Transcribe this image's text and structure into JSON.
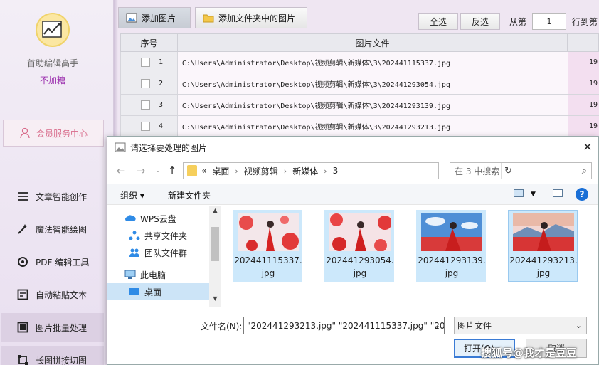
{
  "sidebar": {
    "app_name": "首助编辑高手",
    "user_name": "不加糖",
    "member_center": "会员服务中心",
    "nav": [
      {
        "label": "文章智能创作",
        "icon": "list-icon"
      },
      {
        "label": "魔法智能绘图",
        "icon": "magic-wand-icon"
      },
      {
        "label": "PDF 编辑工具",
        "icon": "pdf-gear-icon"
      },
      {
        "label": "自动粘贴文本",
        "icon": "paste-icon"
      },
      {
        "label": "图片批量处理",
        "icon": "image-batch-icon"
      },
      {
        "label": "长图拼接切图",
        "icon": "crop-icon"
      }
    ]
  },
  "toolbar": {
    "add_images": "添加图片",
    "add_folder_images": "添加文件夹中的图片",
    "select_all": "全选",
    "invert_select": "反选",
    "from_label": "从第",
    "from_value": "1",
    "row_to_label": "行到第"
  },
  "grid": {
    "headers": [
      "序号",
      "图片文件"
    ],
    "rows": [
      {
        "index": "1",
        "path": "C:\\Users\\Administrator\\Desktop\\视频剪辑\\新媒体\\3\\202441115337.jpg",
        "extra": "19"
      },
      {
        "index": "2",
        "path": "C:\\Users\\Administrator\\Desktop\\视频剪辑\\新媒体\\3\\202441293054.jpg",
        "extra": "19"
      },
      {
        "index": "3",
        "path": "C:\\Users\\Administrator\\Desktop\\视频剪辑\\新媒体\\3\\202441293139.jpg",
        "extra": "19"
      },
      {
        "index": "4",
        "path": "C:\\Users\\Administrator\\Desktop\\视频剪辑\\新媒体\\3\\202441293213.jpg",
        "extra": "19"
      }
    ]
  },
  "dialog": {
    "title": "请选择要处理的图片",
    "address": [
      "桌面",
      "视频剪辑",
      "新媒体",
      "3"
    ],
    "address_prefix": "«",
    "search_placeholder": "在 3 中搜索",
    "organize": "组织 ▾",
    "new_folder": "新建文件夹",
    "tree": [
      {
        "label": "WPS云盘",
        "icon": "cloud-icon"
      },
      {
        "label": "共享文件夹",
        "icon": "share-icon"
      },
      {
        "label": "团队文件群",
        "icon": "team-icon"
      },
      {
        "label": "此电脑",
        "icon": "computer-icon"
      },
      {
        "label": "桌面",
        "icon": "desktop-icon"
      }
    ],
    "files": [
      {
        "name": "202441115337.jpg"
      },
      {
        "name": "202441293054.jpg"
      },
      {
        "name": "202441293139.jpg"
      },
      {
        "name": "202441293213.jpg"
      }
    ],
    "filename_label": "文件名(N):",
    "filename_value": "\"202441293213.jpg\" \"202441115337.jpg\" \"20",
    "filetype": "图片文件",
    "open_btn": "打开(O)",
    "cancel_btn": "取消"
  },
  "watermark": "搜狐号@我才是豆豆"
}
